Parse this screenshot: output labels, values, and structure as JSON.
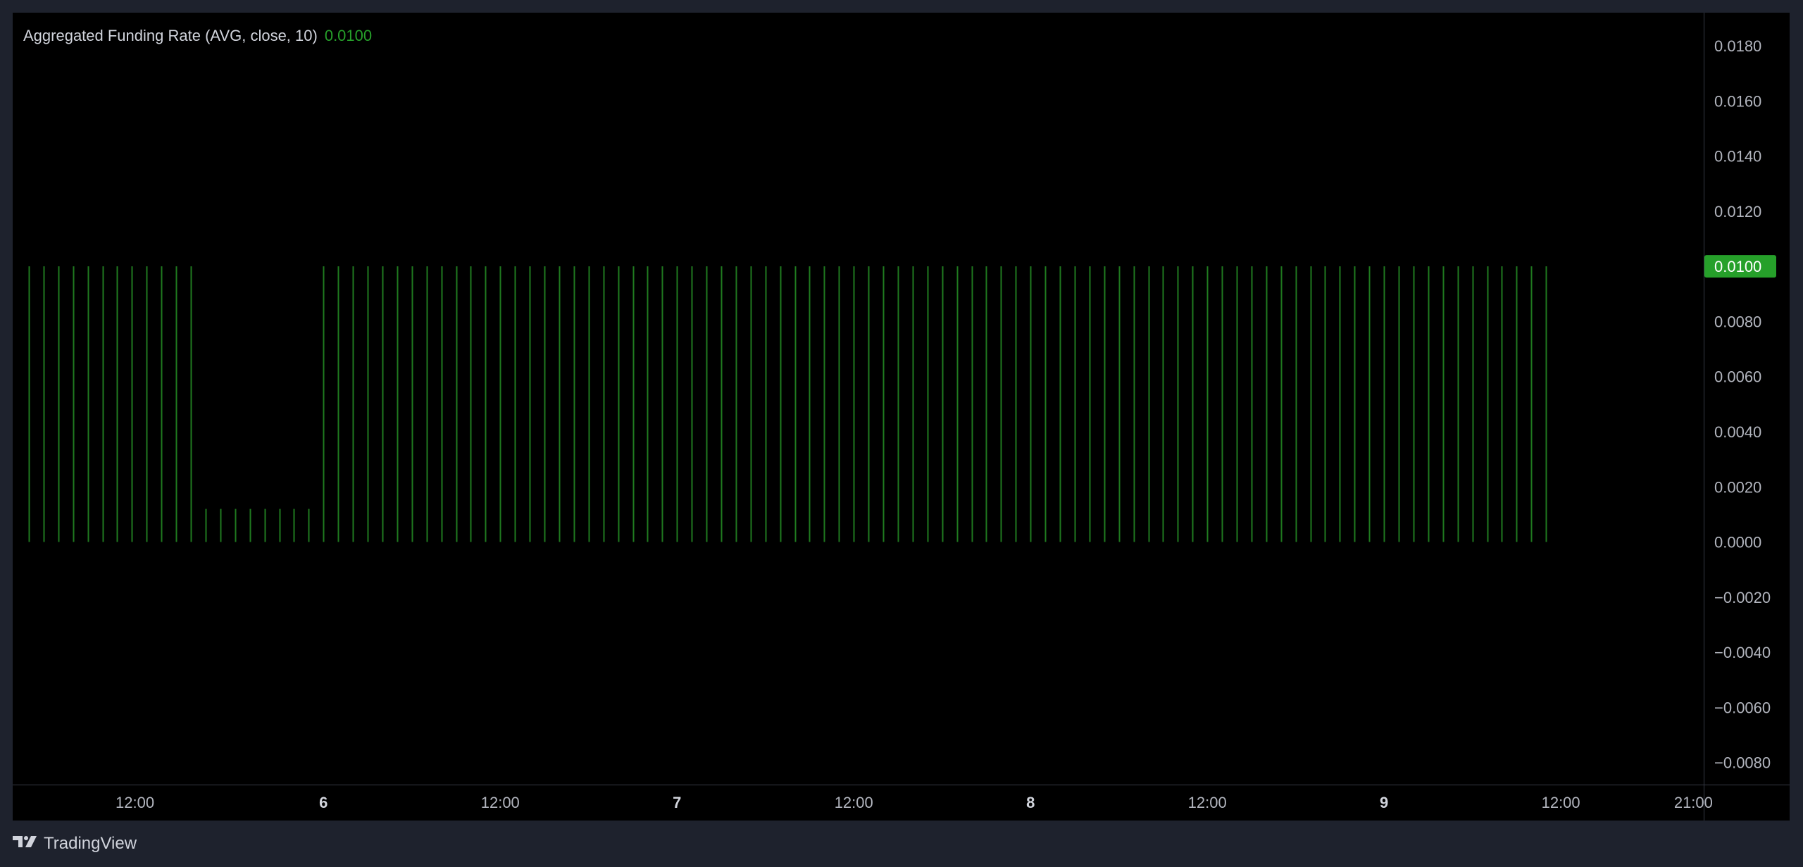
{
  "legend": {
    "title": "Aggregated Funding Rate (AVG, close, 10)",
    "value": "0.0100"
  },
  "footer": {
    "brand": "TradingView",
    "logo_icon": "tradingview-logo-icon"
  },
  "colors": {
    "background": "#000000",
    "frame": "#1e222d",
    "bar": "#1f7a1f",
    "accent": "#26a02a",
    "axis_text": "#b2b5be"
  },
  "chart_data": {
    "type": "bar",
    "title": "Aggregated Funding Rate (AVG, close, 10)",
    "xlabel": "",
    "ylabel": "",
    "ylim": [
      -0.0088,
      0.0192
    ],
    "yticks": [
      "0.0180",
      "0.0160",
      "0.0140",
      "0.0120",
      "0.0100",
      "0.0080",
      "0.0060",
      "0.0040",
      "0.0020",
      "0.0000",
      "−0.0020",
      "−0.0040",
      "−0.0060",
      "−0.0080"
    ],
    "ytick_values": [
      0.018,
      0.016,
      0.014,
      0.012,
      0.01,
      0.008,
      0.006,
      0.004,
      0.002,
      0,
      -0.002,
      -0.004,
      -0.006,
      -0.008
    ],
    "xticks": [
      {
        "label": "12:00",
        "index": 7.2,
        "bold": false
      },
      {
        "label": "6",
        "index": 20,
        "bold": true
      },
      {
        "label": "12:00",
        "index": 32,
        "bold": false
      },
      {
        "label": "7",
        "index": 44,
        "bold": true
      },
      {
        "label": "12:00",
        "index": 56,
        "bold": false
      },
      {
        "label": "8",
        "index": 68,
        "bold": true
      },
      {
        "label": "12:00",
        "index": 80,
        "bold": false
      },
      {
        "label": "9",
        "index": 92,
        "bold": true
      },
      {
        "label": "12:00",
        "index": 104,
        "bold": false
      },
      {
        "label": "21:00",
        "index": 113,
        "bold": false
      }
    ],
    "x_start_index": -1.1,
    "x_end_index": 113.7,
    "values": [
      0.01,
      0.01,
      0.01,
      0.01,
      0.01,
      0.01,
      0.01,
      0.01,
      0.01,
      0.01,
      0.01,
      0.01,
      0.0012,
      0.0012,
      0.0012,
      0.0012,
      0.0012,
      0.0012,
      0.0012,
      0.0012,
      0.01,
      0.01,
      0.01,
      0.01,
      0.01,
      0.01,
      0.01,
      0.01,
      0.01,
      0.01,
      0.01,
      0.01,
      0.01,
      0.01,
      0.01,
      0.01,
      0.01,
      0.01,
      0.01,
      0.01,
      0.01,
      0.01,
      0.01,
      0.01,
      0.01,
      0.01,
      0.01,
      0.01,
      0.01,
      0.01,
      0.01,
      0.01,
      0.01,
      0.01,
      0.01,
      0.01,
      0.01,
      0.01,
      0.01,
      0.01,
      0.01,
      0.01,
      0.01,
      0.01,
      0.01,
      0.01,
      0.01,
      0.01,
      0.01,
      0.01,
      0.01,
      0.01,
      0.01,
      0.01,
      0.01,
      0.01,
      0.01,
      0.01,
      0.01,
      0.01,
      0.01,
      0.01,
      0.01,
      0.01,
      0.01,
      0.01,
      0.01,
      0.01,
      0.01,
      0.01,
      0.01,
      0.01,
      0.01,
      0.01,
      0.01,
      0.01,
      0.01,
      0.01,
      0.01,
      0.01,
      0.01,
      0.01,
      0.01,
      0.01
    ],
    "last_value_label": "0.0100",
    "grid": false,
    "legend": "top-left"
  }
}
